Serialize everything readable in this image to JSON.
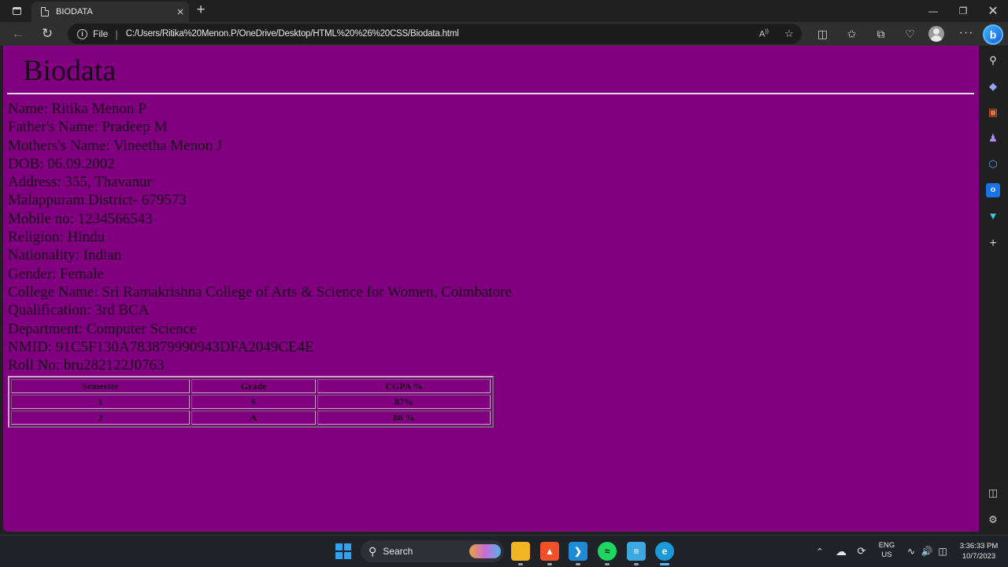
{
  "browser": {
    "tab_title": "BIODATA",
    "address_scheme": "File",
    "address_url": "C:/Users/Ritika%20Menon.P/OneDrive/Desktop/HTML%20%26%20CSS/Biodata.html",
    "icons": [
      "tab-actions-icon",
      "page-icon",
      "close-icon",
      "plus-icon",
      "minimize-icon",
      "maximize-icon",
      "close-window-icon",
      "back-icon",
      "refresh-icon",
      "info-icon",
      "read-aloud-icon",
      "favorite-star-icon",
      "split-screen-icon",
      "favorites-icon",
      "collections-icon",
      "browser-essentials-icon",
      "profile-avatar-icon",
      "more-icon",
      "bing-chat-icon"
    ]
  },
  "page": {
    "heading": "Biodata",
    "lines": [
      "Name: Ritika Menon P",
      "Father's Name: Pradeep M",
      "Mothers's Name: Vineetha Menon J",
      "DOB: 06.09.2002",
      "Address: 355, Thavanur",
      "Malappuram District- 679573",
      "Mobile no: 1234566543",
      "Religion: Hindu",
      "Nationality: Indian",
      "Gender: Female",
      "College Name: Sri Ramakrishna College of Arts & Science for Women, Coimbatore",
      "Qualification: 3rd BCA",
      "Department: Computer Science",
      "NMID: 91C5F130A783879990943DFA2049CE4E",
      "Roll No: bru282122J0763"
    ],
    "table": {
      "headers": [
        "Semester",
        "Grade",
        "CGPA %"
      ],
      "rows": [
        [
          "1",
          "S",
          "87%"
        ],
        [
          "2",
          "A",
          "88 %"
        ]
      ]
    }
  },
  "sidebar_icons": [
    "search-icon",
    "shopping-tag-icon",
    "tools-icon",
    "games-icon",
    "microsoft-365-icon",
    "outlook-icon",
    "drop-icon",
    "add-icon",
    "hide-sidebar-icon",
    "settings-icon"
  ],
  "taskbar": {
    "search_label": "Search",
    "apps": [
      "windows-start-icon",
      "file-explorer-icon",
      "brave-icon",
      "vscode-icon",
      "spotify-icon",
      "notepad-icon",
      "edge-icon"
    ],
    "lang_line1": "ENG",
    "lang_line2": "US",
    "time": "3:36:33 PM",
    "date": "10/7/2023"
  },
  "colors": {
    "page_background": "#800080",
    "browser_chrome": "#202020",
    "taskbar": "#1f2227"
  }
}
